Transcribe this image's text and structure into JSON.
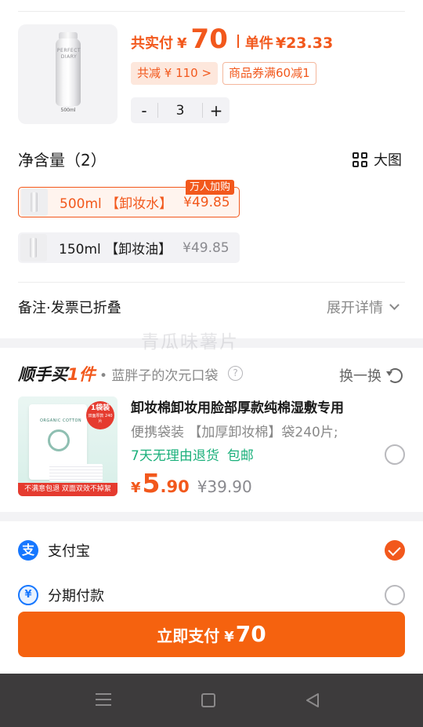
{
  "order": {
    "paid_label": "共实付",
    "currency": "¥",
    "paid_amount": "70",
    "unit_label": "单件",
    "unit_price": "¥23.33",
    "reduce_chip": "共减 ¥ 110 >",
    "coupon_chip": "商品券满60减1",
    "quantity": "3",
    "minus": "-",
    "plus": "+",
    "product_image": {
      "brand_text": "PERFECT DIARY",
      "size_text": "500ml"
    }
  },
  "spec": {
    "title": "净含量（2）",
    "bigpic_label": "大图",
    "hot_tag": "万人加购",
    "options": [
      {
        "name": "500ml 【卸妆水】",
        "price": "¥49.85",
        "selected": true
      },
      {
        "name": "150ml 【卸妆油】",
        "price": "¥49.85",
        "selected": false
      }
    ]
  },
  "remark": {
    "label": "备注·发票已折叠",
    "expand_label": "展开详情"
  },
  "watermark": "青瓜味薯片",
  "addon": {
    "title_plain": "顺手买",
    "title_accent": "1件",
    "subtitle": "• 蓝胖子的次元口袋",
    "help_icon": "?",
    "swap_label": "换一换",
    "product_name": "卸妆棉卸妆用脸部厚款纯棉湿敷专用",
    "description": "便携袋装 【加厚卸妆棉】袋240片;",
    "services": [
      "7天无理由退货",
      "包邮"
    ],
    "currency": "¥",
    "price_int": "5",
    "price_dec": ".90",
    "original_price": "¥39.90",
    "image": {
      "bag_label": "ORGANIC COTTON",
      "badge_main": "1袋装",
      "badge_sub": "双面厚款 240片",
      "banner": "不满意包退  双面双效不掉絮"
    }
  },
  "payment": {
    "methods": [
      {
        "icon_text": "支",
        "label": "支付宝",
        "selected": true
      },
      {
        "icon_text": "¥",
        "label": "分期付款",
        "selected": false
      }
    ],
    "pay_button_label": "立即支付",
    "pay_button_currency": "¥",
    "pay_button_amount": "70"
  },
  "colors": {
    "accent": "#f2581c",
    "success": "#1bb07b",
    "alipay": "#1677ff",
    "navbar": "#3d3b3c"
  },
  "icons": [
    "grid-view-icon",
    "chevron-down-icon",
    "help-icon",
    "refresh-icon",
    "checkmark-icon",
    "menu-icon",
    "home-icon",
    "back-icon"
  ]
}
